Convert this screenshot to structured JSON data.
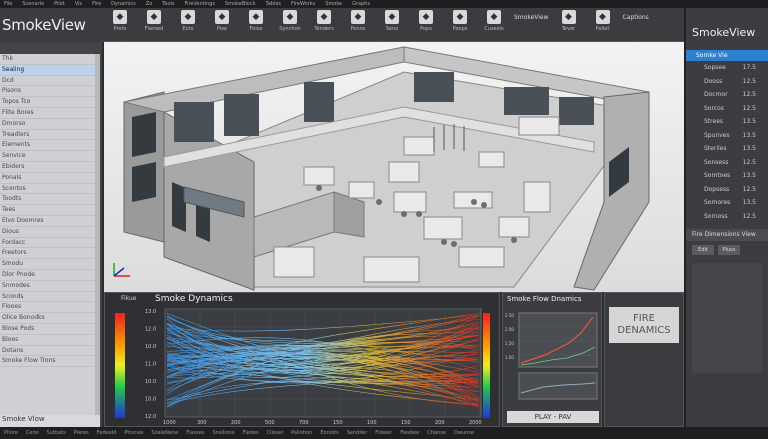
{
  "app": {
    "title": "SmokeView"
  },
  "menu": [
    "File",
    "Scenario",
    "Pilot",
    "Vis",
    "Fire",
    "Dynamics",
    "Zo",
    "Tools",
    "FireVentings",
    "SmokeBlock",
    "Tables",
    "FireWorks",
    "Smoke",
    "Graphs"
  ],
  "toolbar": {
    "tools": [
      {
        "icon": "folder-icon",
        "label": "Proto"
      },
      {
        "icon": "grid-icon",
        "label": "Flamed"
      },
      {
        "icon": "edit-icon",
        "label": "Eoto"
      },
      {
        "icon": "circle-icon",
        "label": "Pow"
      },
      {
        "icon": "view-icon",
        "label": "Foise"
      },
      {
        "icon": "room-icon",
        "label": "Synchon"
      },
      {
        "icon": "fan-icon",
        "label": "Tenders"
      },
      {
        "icon": "tank-icon",
        "label": "Ponos"
      },
      {
        "icon": "smoke-icon",
        "label": "Seno"
      },
      {
        "icon": "pipe-icon",
        "label": "Pops"
      },
      {
        "icon": "flame-icon",
        "label": "Poops"
      },
      {
        "icon": "vent-icon",
        "label": "Cuseels"
      },
      {
        "icon": "stack-icon",
        "label": "Tever"
      },
      {
        "icon": "table-icon",
        "label": "Pallet"
      }
    ],
    "extra_text": "SmokeView",
    "extra_right": "Captions"
  },
  "left_panel": {
    "items": [
      "Thk",
      "Sealing",
      "Dcd",
      "Pisons",
      "Topos Tco",
      "Flite Bores",
      "Dmorso",
      "Treadlers",
      "Elements",
      "Senvice",
      "Ebiders",
      "Ponals",
      "Scentos",
      "Toodts",
      "Tees",
      "Elvo Doomres",
      "Dious",
      "Fordacc",
      "Freetors",
      "Smodu",
      "Dlor Pnode",
      "Snmodes",
      "Sconds",
      "Flooes",
      "Olice Bonodks",
      "Blose Pods",
      "Bloes",
      "Dotans",
      "Smoke Flow Trons"
    ],
    "selected_index": 1,
    "footer": "Smoke Vlow"
  },
  "viewport": {
    "label": "3D building model"
  },
  "right_panel": {
    "title": "SmokeView",
    "selected": "Somke Vie",
    "items": [
      {
        "label": "Sopsee",
        "value": "17.5"
      },
      {
        "label": "Dooss",
        "value": "12.5"
      },
      {
        "label": "Docmor",
        "value": "12.5"
      },
      {
        "label": "Sorcos",
        "value": "12.5"
      },
      {
        "label": "Strees",
        "value": "13.5"
      },
      {
        "label": "Spunves",
        "value": "13.5"
      },
      {
        "label": "Steriles",
        "value": "13.5"
      },
      {
        "label": "Sonsess",
        "value": "12.5"
      },
      {
        "label": "Somtoes",
        "value": "13.5"
      },
      {
        "label": "Dopsess",
        "value": "12.5"
      },
      {
        "label": "Somores",
        "value": "13.5"
      },
      {
        "label": "Sornoss",
        "value": "12.5"
      }
    ],
    "section": "Fire Dimensions View",
    "buttons": [
      "Edit",
      "Pluss"
    ]
  },
  "main_chart": {
    "tag": "Fikue",
    "title": "Smoke Dynamics",
    "yticks": [
      "13.0",
      "12.0",
      "10.0",
      "11.0",
      "10.0",
      "10.0",
      "12.0"
    ],
    "xticks": [
      "1000",
      "300",
      "200",
      "500",
      "700",
      "150",
      "100",
      "150",
      "200",
      "2000"
    ]
  },
  "side_chart": {
    "title": "Smoke Flow Dnamics",
    "play": "PLAY - PAV"
  },
  "fire_box": {
    "text": "FIRE DENAMICS"
  },
  "status": [
    "Pllore",
    "Ceno",
    "Sutbats",
    "Pieres",
    "Fedeeld",
    "Ptrunes",
    "SoaleNene",
    "Flasses",
    "Snsilions",
    "Fledes",
    "Cllesel",
    "Pallotion",
    "Eonlots",
    "Sendiler",
    "Fldaler",
    "Fiesbee",
    "Ctlanse",
    "Dwunse"
  ],
  "colors": {
    "accent": "#2d7fd0",
    "panel": "#3b3d41",
    "light_panel": "#cfd0d3"
  }
}
